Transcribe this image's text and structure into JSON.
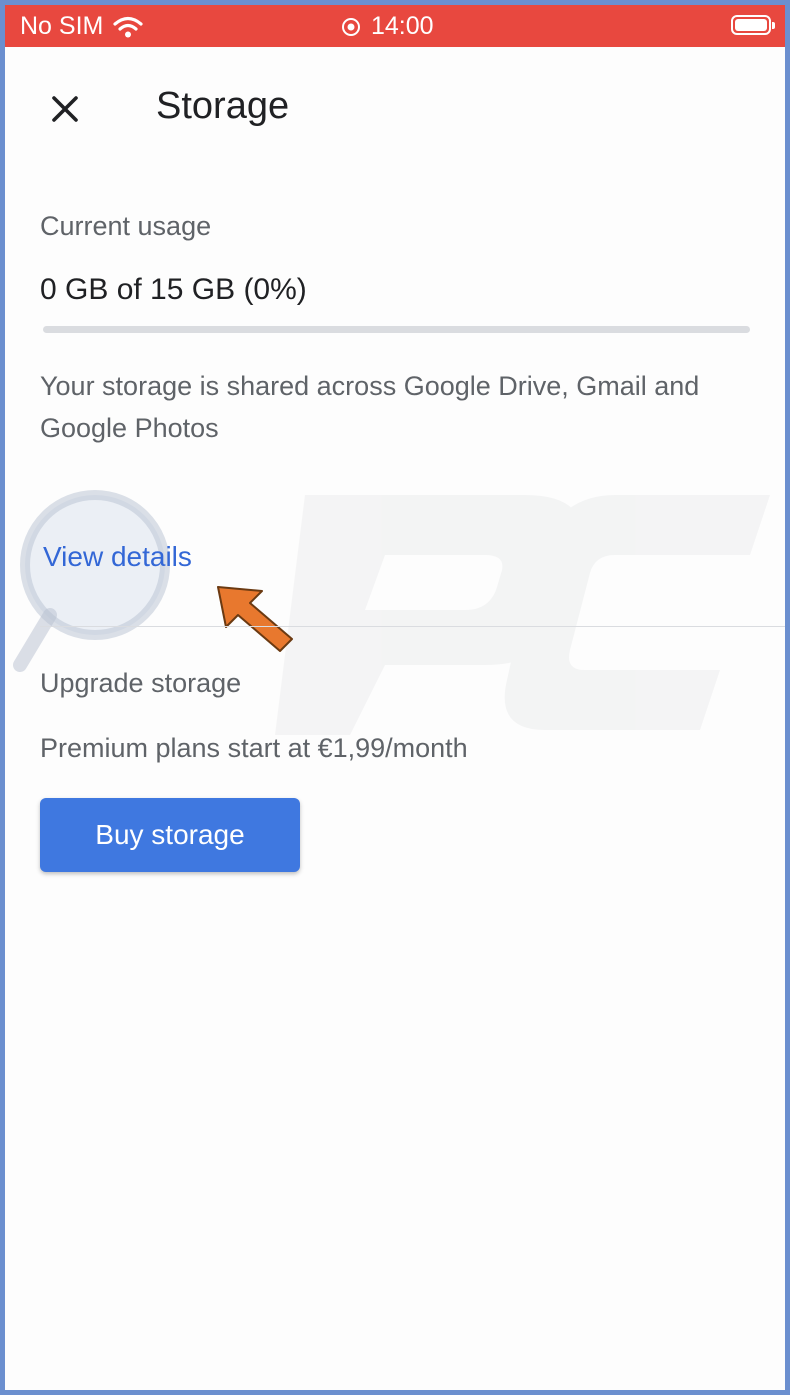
{
  "status_bar": {
    "carrier": "No SIM",
    "time": "14:00",
    "icons": [
      "wifi-icon",
      "location-icon",
      "battery-icon"
    ]
  },
  "header": {
    "title": "Storage",
    "close_icon": "close-icon"
  },
  "usage": {
    "label": "Current usage",
    "value": "0 GB of 15 GB (0%)",
    "percent": 0,
    "description": "Your storage is shared across Google Drive, Gmail and Google Photos",
    "link": "View details"
  },
  "upgrade": {
    "label": "Upgrade storage",
    "subtitle": "Premium plans start at €1,99/month",
    "button": "Buy storage"
  },
  "colors": {
    "status_bar": "#e8483f",
    "link": "#3367d6",
    "button": "#3f78e0",
    "arrow": "#e8782e"
  }
}
